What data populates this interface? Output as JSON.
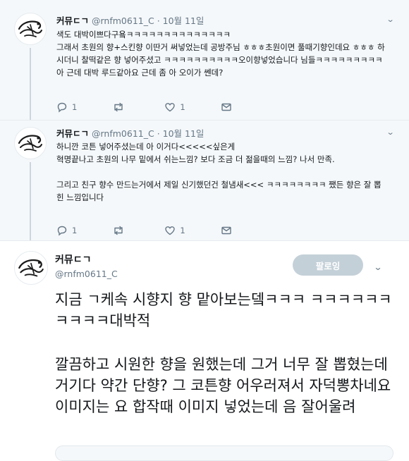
{
  "tweets": [
    {
      "name": "커뮤ㄷㄱ",
      "handle": "@rnfm0611_C",
      "date": "· 10월 11일",
      "text": "색도 대박이쁘다구욬ㅋㅋㅋㅋㅋㅋㅋㅋㅋㅋㅋㅋㅋㅋ\n그래서 초원의 향+스킨향 이딴거 써넣었는데 공방주님 ㅎㅎㅎ초원이면 풀때기향인데요 ㅎㅎㅎ 하시더니 찰떡같은 향 넣어주셨고 ㅋㅋㅋㅋㅋㅋㅋㅋㅋㅋ오이향넣었습니다 님들ㅋㅋㅋㅋㅋㅋㅋㅋㅋ아 근데 대박 루드같아요 근데 좀 아 오이가 쎈데?",
      "reply_count": "1",
      "like_count": "1"
    },
    {
      "name": "커뮤ㄷㄱ",
      "handle": "@rnfm0611_C",
      "date": "· 10월 11일",
      "text": "하니깐 코튼 넣어주셨는데 아 이거다<<<<<싶은게\n혁명끝나고 초원의 나무 밑에서 쉬는느낌? 보다 조금 더 젊을때의 느낌? 나서 만족.\n\n그리고 친구 향수 만드는거에서 제일 신기했던건 철냄새<<< ㅋㅋㅋㅋㅋㅋㅋㅋ 쨌든 향은 잘 뽑힌 느낌입니다",
      "reply_count": "1",
      "like_count": "1"
    }
  ],
  "main_tweet": {
    "name": "커뮤ㄷㄱ",
    "handle": "@rnfm0611_C",
    "follow_label": "팔로잉",
    "text_1": "지금 ㄱ케속 시향지 향 맡아보는뎈ㅋㅋㅋ ㅋㅋㅋㅋㅋㅋㅋㅋㅋㅋ대박적",
    "text_2": "깔끔하고 시원한 향을 원했는데 그거 너무 잘 뽑혔는데 거기다 약간 단향? 그 코튼향 어우러져서 자덕뽕차네요 이미지는 요 합작때 이미지 넣었는데 음 잘어울려"
  },
  "colors": {
    "thread_bg": "#f5f8fa",
    "secondary_text": "#657786",
    "follow_button": "#c4d0d8"
  }
}
